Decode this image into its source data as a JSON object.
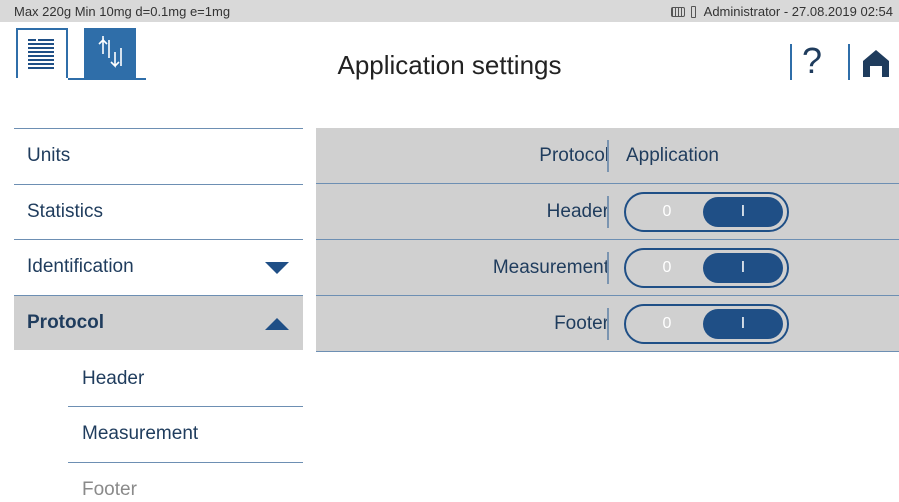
{
  "status": {
    "capacity": "Max 220g  Min 10mg  d=0.1mg  e=1mg",
    "user_time": "Administrator  -  27.08.2019 02:54"
  },
  "header": {
    "title": "Application settings",
    "help_label": "?"
  },
  "nav": {
    "items": [
      {
        "label": "Units"
      },
      {
        "label": "Statistics"
      },
      {
        "label": "Identification"
      },
      {
        "label": "Protocol"
      }
    ],
    "subitems": [
      {
        "label": "Header"
      },
      {
        "label": "Measurement"
      },
      {
        "label": "Footer"
      }
    ]
  },
  "panel": {
    "col_protocol": "Protocol",
    "col_application": "Application",
    "rows": [
      {
        "label": "Header",
        "off": "0",
        "on": "I",
        "state": "on"
      },
      {
        "label": "Measurement",
        "off": "0",
        "on": "I",
        "state": "on"
      },
      {
        "label": "Footer",
        "off": "0",
        "on": "I",
        "state": "on"
      }
    ]
  },
  "colors": {
    "accent": "#2f6ea9",
    "toggle_on": "#1f4f86",
    "panel_bg": "#d0d0d0"
  }
}
